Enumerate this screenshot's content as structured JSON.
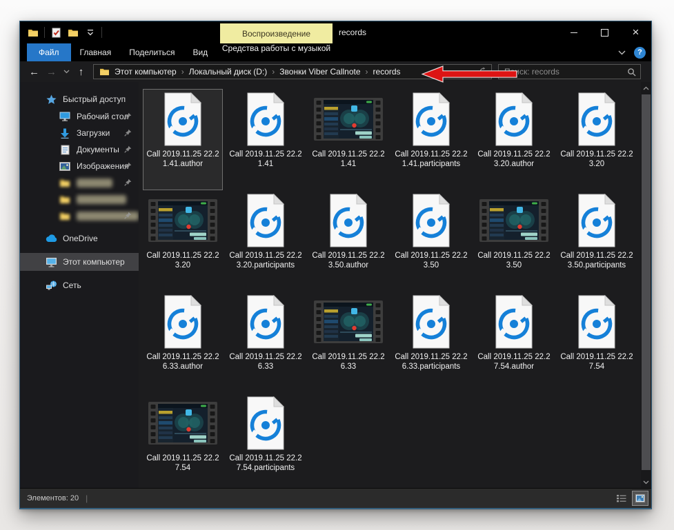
{
  "window": {
    "title": "records"
  },
  "titlebar": {
    "contextual_group": "Воспроизведение",
    "title": "records"
  },
  "ribbon": {
    "tabs": [
      {
        "label": "Файл"
      },
      {
        "label": "Главная"
      },
      {
        "label": "Поделиться"
      },
      {
        "label": "Вид"
      }
    ],
    "contextual_tab": "Средства работы с музыкой"
  },
  "addressbar": {
    "breadcrumb": [
      "Этот компьютер",
      "Локальный диск (D:)",
      "Звонки Viber Callnote",
      "records"
    ],
    "search_placeholder": "Поиск: records"
  },
  "sidebar": {
    "items": [
      {
        "label": "Быстрый доступ",
        "icon": "quick-access-star",
        "level": 0
      },
      {
        "label": "Рабочий стол",
        "icon": "desktop",
        "level": 1,
        "pinned": true
      },
      {
        "label": "Загрузки",
        "icon": "downloads",
        "level": 1,
        "pinned": true
      },
      {
        "label": "Документы",
        "icon": "documents",
        "level": 1,
        "pinned": true
      },
      {
        "label": "Изображения",
        "icon": "pictures",
        "level": 1,
        "pinned": true
      },
      {
        "redacted": true,
        "icon": "folder",
        "level": 1,
        "pinned": true,
        "blob_width": 52
      },
      {
        "redacted": true,
        "icon": "folder",
        "level": 1,
        "blob_width": 72
      },
      {
        "redacted": true,
        "icon": "folder",
        "level": 1,
        "pinned": true,
        "blob_width": 112
      },
      {
        "label": "OneDrive",
        "icon": "onedrive",
        "level": 0,
        "group_start": true
      },
      {
        "label": "Этот компьютер",
        "icon": "computer",
        "level": 0,
        "selected": true,
        "group_start": true
      },
      {
        "label": "Сеть",
        "icon": "network",
        "level": 0,
        "group_start": true
      }
    ]
  },
  "files": [
    {
      "name": "Call 2019.11.25 22.21.41.author",
      "type": "audio",
      "selected": true
    },
    {
      "name": "Call 2019.11.25 22.21.41",
      "type": "audio"
    },
    {
      "name": "Call 2019.11.25 22.21.41",
      "type": "video"
    },
    {
      "name": "Call 2019.11.25 22.21.41.participants",
      "type": "audio"
    },
    {
      "name": "Call 2019.11.25 22.23.20.author",
      "type": "audio"
    },
    {
      "name": "Call 2019.11.25 22.23.20",
      "type": "audio"
    },
    {
      "name": "Call 2019.11.25 22.23.20",
      "type": "video"
    },
    {
      "name": "Call 2019.11.25 22.23.20.participants",
      "type": "audio"
    },
    {
      "name": "Call 2019.11.25 22.23.50.author",
      "type": "audio"
    },
    {
      "name": "Call 2019.11.25 22.23.50",
      "type": "audio"
    },
    {
      "name": "Call 2019.11.25 22.23.50",
      "type": "video"
    },
    {
      "name": "Call 2019.11.25 22.23.50.participants",
      "type": "audio"
    },
    {
      "name": "Call 2019.11.25 22.26.33.author",
      "type": "audio"
    },
    {
      "name": "Call 2019.11.25 22.26.33",
      "type": "audio"
    },
    {
      "name": "Call 2019.11.25 22.26.33",
      "type": "video"
    },
    {
      "name": "Call 2019.11.25 22.26.33.participants",
      "type": "audio"
    },
    {
      "name": "Call 2019.11.25 22.27.54.author",
      "type": "audio"
    },
    {
      "name": "Call 2019.11.25 22.27.54",
      "type": "audio"
    },
    {
      "name": "Call 2019.11.25 22.27.54",
      "type": "video"
    },
    {
      "name": "Call 2019.11.25 22.27.54.participants",
      "type": "audio"
    }
  ],
  "statusbar": {
    "items_count_label": "Элементов: 20"
  },
  "icons": {
    "back": "←",
    "forward": "→",
    "up": "↑",
    "close": "×",
    "help": "?",
    "crumb_separator": "›"
  },
  "annotation": {
    "type": "arrow-left",
    "color": "#dd1414",
    "points_at": "records breadcrumb segment"
  }
}
